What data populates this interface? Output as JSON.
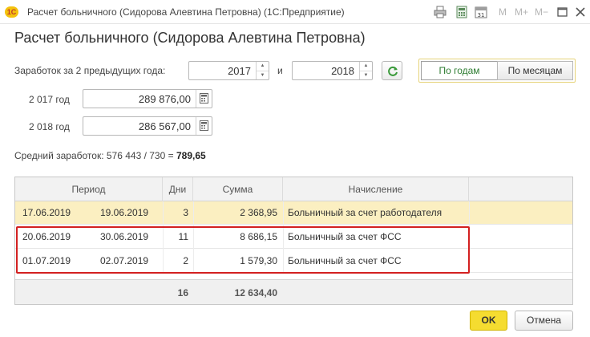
{
  "window": {
    "app_icon": "1C",
    "title": "Расчет больничного (Сидорова Алевтина Петровна)  (1С:Предприятие)",
    "tools": {
      "m": "M",
      "m_plus": "M+",
      "m_minus": "M−"
    }
  },
  "heading": "Расчет больничного (Сидорова Алевтина Петровна)",
  "period": {
    "label": "Заработок за 2 предыдущих года:",
    "year_from": "2017",
    "and_label": "и",
    "year_to": "2018"
  },
  "toggle": {
    "by_years": "По годам",
    "by_months": "По месяцам",
    "active": "by_years"
  },
  "earnings": [
    {
      "label": "2 017 год",
      "value": "289 876,00"
    },
    {
      "label": "2 018 год",
      "value": "286 567,00"
    }
  ],
  "average": {
    "text": "Средний заработок: 576 443 / 730 = ",
    "result": "789,65"
  },
  "table": {
    "headers": {
      "period": "Период",
      "days": "Дни",
      "sum": "Сумма",
      "accrual": "Начисление"
    },
    "rows": [
      {
        "from": "17.06.2019",
        "to": "19.06.2019",
        "days": "3",
        "sum": "2 368,95",
        "accrual": "Больничный за счет работодателя",
        "selected": true
      },
      {
        "from": "20.06.2019",
        "to": "30.06.2019",
        "days": "11",
        "sum": "8 686,15",
        "accrual": "Больничный за счет ФСС",
        "selected": false
      },
      {
        "from": "01.07.2019",
        "to": "02.07.2019",
        "days": "2",
        "sum": "1 579,30",
        "accrual": "Больничный за счет ФСС",
        "selected": false
      }
    ],
    "totals": {
      "days": "16",
      "sum": "12 634,40"
    }
  },
  "buttons": {
    "ok": "OK",
    "cancel": "Отмена"
  },
  "colors": {
    "accent_yellow": "#f5dc30",
    "selected_row": "#fbefc1",
    "highlight_red": "#d32020",
    "active_green": "#2e7d32"
  }
}
